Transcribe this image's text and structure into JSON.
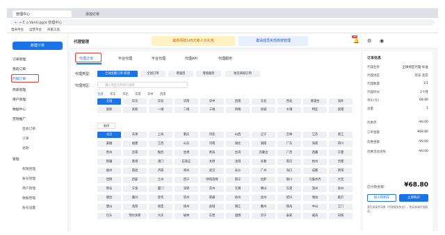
{
  "browser": {
    "tab1": "管理中心",
    "tab2": "添加订单",
    "url": "← → C  ⌂  Vanti.pg/a 管理中心",
    "bookmarks": [
      "电商平台",
      "运营平台",
      "商家工具"
    ]
  },
  "sidebar": {
    "new_button": "新建订单",
    "items": [
      "订单管理",
      "我的订单",
      "代理订单",
      "商家管理",
      "用户管理",
      "数据中心",
      "营销推广"
    ],
    "subitems": [
      "签收订单",
      "订单",
      "退款"
    ],
    "group2": "管理",
    "subitems2": [
      "权限管理",
      "账号管理",
      "用户管理",
      "数据管理",
      "账号设置"
    ]
  },
  "header": {
    "title": "代理管理",
    "promo1": "最高领取145元新人大礼包",
    "promo2": "邀请成员实现高效管理",
    "badge_count": "99"
  },
  "tabs": [
    "代理订单",
    "平台代理",
    "平台代理",
    "代理API",
    "代理服务"
  ],
  "form": {
    "type_label": "代理类型:",
    "types": [
      "全球金额订单-新建",
      "全国订单",
      "增强型",
      "增值服务",
      "收货商城订单"
    ],
    "region_label": "代理地区:",
    "search_placeholder": "输入地区名称进行搜索"
  },
  "filters": [
    "全部",
    "华东",
    "华北",
    "华南",
    "华中",
    "西南"
  ],
  "hot": [
    "全国",
    "华东",
    "华北",
    "华南",
    "华中",
    "西南",
    "东北",
    "西北",
    "港澳台",
    "海外",
    "国际",
    "其他",
    "一线",
    "二线",
    "三线",
    "四线",
    "县城",
    "乡镇",
    "特区",
    "直辖"
  ],
  "select": "省份",
  "grid": [
    [
      "北京",
      "天津",
      "上海",
      "重庆",
      "河北",
      "山西",
      "辽宁",
      "吉林",
      "江苏",
      "浙江"
    ],
    [
      "安徽",
      "福建",
      "江西",
      "山东",
      "河南",
      "湖北",
      "湖南",
      "广东",
      "海南",
      "四川"
    ],
    [
      "贵州",
      "云南",
      "陕西",
      "甘肃",
      "青海",
      "台湾",
      "内蒙古",
      "广西",
      "西藏",
      "宁夏"
    ],
    [
      "新疆",
      "香港",
      "澳门",
      "石家庄",
      "太原",
      "沈阳",
      "长春",
      "南京",
      "杭州",
      "合肥"
    ],
    [
      "福州",
      "南昌",
      "济南",
      "郑州",
      "武汉",
      "长沙",
      "广州",
      "海口",
      "成都",
      "贵阳"
    ],
    [
      "昆明",
      "西安",
      "兰州",
      "西宁",
      "呼和浩特",
      "南宁",
      "拉萨",
      "银川",
      "乌鲁木齐",
      "大连"
    ],
    [
      "青岛",
      "宁波",
      "厦门",
      "深圳",
      "苏州",
      "无锡",
      "佛山",
      "东莞",
      "温州",
      "泉州"
    ],
    [
      "烟台",
      "嘉兴",
      "金华",
      "常州",
      "南通",
      "徐州",
      "台州",
      "绍兴",
      "潍坊",
      "临沂"
    ],
    [
      "唐山",
      "洛阳",
      "保定",
      "扬州",
      "盐城",
      "镇江",
      "惠州",
      "珠海",
      "中山",
      "江门"
    ],
    [
      "包头",
      "鄂尔多斯",
      "大庆",
      "榆林",
      "东营",
      "淄博",
      "济宁",
      "泰安",
      "威海",
      "日照"
    ]
  ],
  "summary": {
    "title": "订单信息",
    "rows": [
      [
        "代理名称",
        "全球地区代理-标准"
      ],
      [
        "代理地区",
        "华东 北京"
      ],
      [
        "代理数量",
        "1/1"
      ],
      [
        "代理时长",
        "1个月"
      ],
      [
        "单价(元)",
        "68.80"
      ],
      [
        "总量",
        "1"
      ]
    ],
    "rows2": [
      [
        "优惠券",
        "-¥0.00"
      ],
      [
        "订单金额",
        "¥68.80"
      ],
      [
        "优惠金额",
        "-¥0.00"
      ],
      [
        "优惠活动减免",
        "-¥0.00"
      ]
    ],
    "total_label": "应付款金额:",
    "total": "¥68.80",
    "btn1": "加入购物车",
    "btn2": "立即购买",
    "note": "我已阅读并同意《代理服务协议》，购买前请仔细阅读。"
  }
}
